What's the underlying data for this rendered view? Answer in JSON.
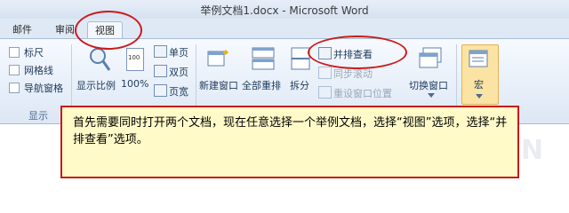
{
  "window": {
    "title": "举例文档1.docx - Microsoft Word"
  },
  "tabs": [
    {
      "label": "邮件"
    },
    {
      "label": "审阅"
    },
    {
      "label": "视图"
    }
  ],
  "ribbon": {
    "show_group": {
      "items": [
        {
          "label": "标尺"
        },
        {
          "label": "网格线"
        },
        {
          "label": "导航窗格"
        }
      ],
      "group_label": "显示"
    },
    "zoom_group": {
      "zoom_label": "显示比例",
      "hundred_label": "100%",
      "one_page": "单页",
      "two_page": "双页",
      "page_width": "页宽",
      "hundred_badge": "100"
    },
    "window_group": {
      "new_window": "新建窗口",
      "arrange_all": "全部重排",
      "split": "拆分",
      "side_by_side": "并排查看",
      "sync_scroll": "同步滚动",
      "reset_position": "重设窗口位置",
      "switch_windows": "切换窗口"
    },
    "macro_group": {
      "macro": "宏"
    }
  },
  "callout": {
    "text": "首先需要同时打开两个文档，现在任意选择一个举例文档，选择“视图”选项，选择“并排查看”选项。"
  },
  "colors": {
    "highlight": "#cc1b1b",
    "callout_bg": "#fffac8"
  }
}
